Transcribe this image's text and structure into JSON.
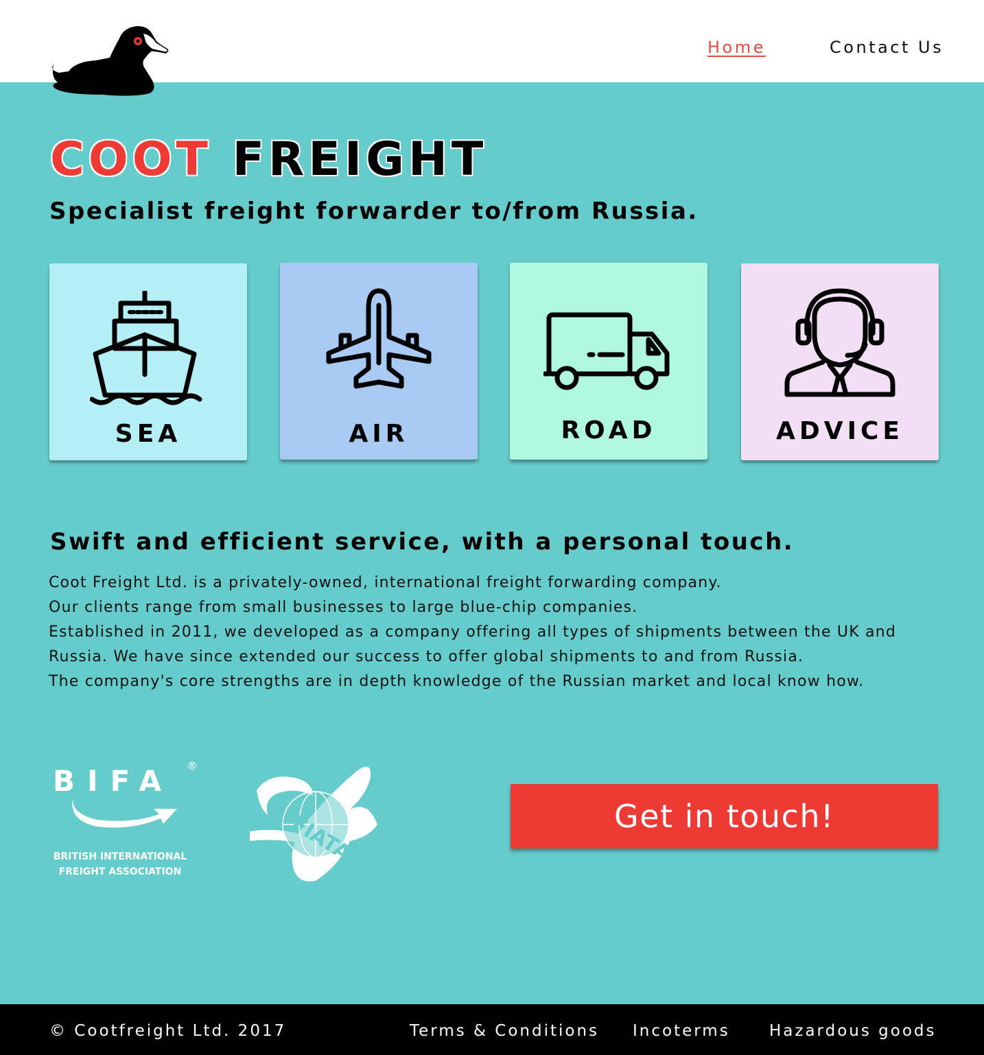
{
  "header": {
    "logo_icon": "coot-bird-logo",
    "nav": [
      {
        "label": "Home",
        "active": true
      },
      {
        "label": "Contact Us",
        "active": false
      }
    ]
  },
  "hero": {
    "title_part1": "COOT",
    "title_part2": "FREIGHT",
    "subtitle": "Specialist freight forwarder to/from Russia."
  },
  "services": [
    {
      "label": "SEA",
      "icon": "ship-icon",
      "color": "#b3eff5"
    },
    {
      "label": "AIR",
      "icon": "airplane-icon",
      "color": "#a9caf2"
    },
    {
      "label": "ROAD",
      "icon": "truck-icon",
      "color": "#aff7de"
    },
    {
      "label": "ADVICE",
      "icon": "headset-agent-icon",
      "color": "#f2dff5"
    }
  ],
  "about": {
    "heading": "Swift and efficient service, with a personal touch.",
    "lines": [
      "Coot Freight Ltd. is a privately-owned, international freight forwarding company.",
      "Our clients range from small businesses to large blue-chip companies.",
      "Established in 2011, we developed as a company offering all types of shipments between the UK and",
      "Russia. We have since extended our success to offer global shipments to and from Russia.",
      "The company's core strengths are in depth knowledge of the Russian market and local know how."
    ]
  },
  "affiliations": {
    "bifa": {
      "wordmark": "BIFA",
      "registered": "®",
      "line1": "BRITISH INTERNATIONAL",
      "line2": "FREIGHT ASSOCIATION"
    },
    "fiata": {
      "wordmark": "FIATA"
    }
  },
  "cta": {
    "label": "Get in touch!"
  },
  "footer": {
    "copyright": "© Cootfreight Ltd. 2017",
    "links": [
      "Terms & Conditions",
      "Incoterms",
      "Hazardous goods"
    ]
  },
  "colors": {
    "background": "#66cccb",
    "accent": "#ee3a35",
    "header": "#ffffff",
    "footer": "#000000"
  }
}
